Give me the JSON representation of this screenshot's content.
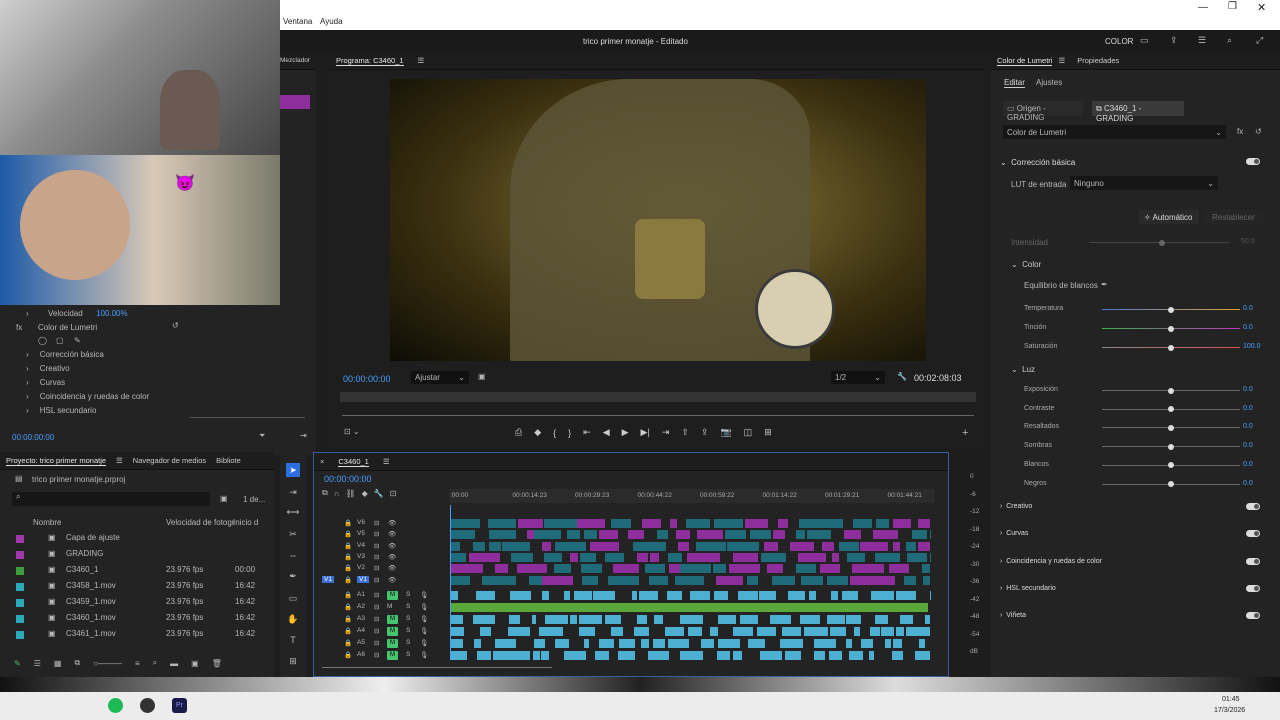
{
  "menu": {
    "items": [
      "Ventana",
      "Ayuda"
    ]
  },
  "window": {
    "title": "trico primer monatje - Editado",
    "workspace": "COLOR"
  },
  "source_tabs": {
    "mezclador": "Mezclador"
  },
  "effect_controls": {
    "velocidad_label": "Velocidad",
    "velocidad_value": "100.00%",
    "lumetri_label": "Color de Lumetri",
    "sections": [
      "Corrección básica",
      "Creativo",
      "Curvas",
      "Coincidencia y ruedas de color",
      "HSL secundario"
    ],
    "timecode": "00:00:00:00"
  },
  "program": {
    "title": "Programa: C3460_1",
    "timecode": "00:00:00:00",
    "fit": "Ajustar",
    "quality": "1/2",
    "duration": "00:02:08:03"
  },
  "project": {
    "tab_project": "Proyecto: trico primer monatje",
    "tab_media": "Navegador de medios",
    "tab_library": "Bibliote",
    "file": "trico primer monatje.prproj",
    "count": "1 de...",
    "col_name": "Nombre",
    "col_fps": "Velocidad de fotogr",
    "col_start": "Inicio d",
    "items": [
      {
        "name": "Capa de ajuste",
        "fps": "",
        "start": "",
        "color": "#9b3aa8"
      },
      {
        "name": "GRADING",
        "fps": "",
        "start": "",
        "color": "#9b3aa8"
      },
      {
        "name": "C3460_1",
        "fps": "23.976 fps",
        "start": "00:00",
        "color": "#3f9d3a"
      },
      {
        "name": "C3458_1.mov",
        "fps": "23.976 fps",
        "start": "16:42",
        "color": "#2aa7b8"
      },
      {
        "name": "C3459_1.mov",
        "fps": "23.976 fps",
        "start": "16:42",
        "color": "#2aa7b8"
      },
      {
        "name": "C3460_1.mov",
        "fps": "23.976 fps",
        "start": "16:42",
        "color": "#2aa7b8"
      },
      {
        "name": "C3461_1.mov",
        "fps": "23.976 fps",
        "start": "16:42",
        "color": "#2aa7b8"
      }
    ]
  },
  "timeline": {
    "tab": "C3460_1",
    "timecode": "00:00:00:00",
    "ruler": [
      ":00:00",
      "00:00:14:23",
      "00:00:29:23",
      "00:00:44:22",
      "00:00:59:22",
      "00:01:14:22",
      "00:01:29:21",
      "00:01:44:21"
    ],
    "video_tracks": [
      "V6",
      "V5",
      "V4",
      "V3",
      "V2",
      "V1"
    ],
    "audio_tracks": [
      "A1",
      "A2",
      "A3",
      "A4",
      "A5",
      "A6"
    ]
  },
  "meter": {
    "scale": [
      "0",
      "-6",
      "-12",
      "-18",
      "-24",
      "-30",
      "-36",
      "-42",
      "-48",
      "-54",
      "dB"
    ]
  },
  "lumetri": {
    "tab": "Color de Lumetri",
    "tab2": "Propiedades",
    "sub_edit": "Editar",
    "sub_adjust": "Ajustes",
    "source": "Origen - GRADING",
    "target": "C3460_1 - GRADING",
    "effect": "Color de Lumetri",
    "basic": "Corrección básica",
    "lut_label": "LUT de entrada",
    "lut_value": "Ninguno",
    "auto": "Automático",
    "reset": "Restablecer",
    "intensity": "Intensidad",
    "intensity_val": "50.0",
    "color": "Color",
    "wb": "Equilibrio de blancos",
    "sliders": [
      {
        "label": "Temperatura",
        "value": "0.0"
      },
      {
        "label": "Tinción",
        "value": "0.0"
      },
      {
        "label": "Saturación",
        "value": "100.0"
      }
    ],
    "light": "Luz",
    "light_sliders": [
      {
        "label": "Exposición",
        "value": "0.0"
      },
      {
        "label": "Contraste",
        "value": "0.0"
      },
      {
        "label": "Resaltados",
        "value": "0.0"
      },
      {
        "label": "Sombras",
        "value": "0.0"
      },
      {
        "label": "Blancos",
        "value": "0.0"
      },
      {
        "label": "Negros",
        "value": "0.0"
      }
    ],
    "groups": [
      "Creativo",
      "Curvas",
      "Coincidencia y ruedas de color",
      "HSL secundario",
      "Viñeta"
    ]
  },
  "taskbar": {
    "time": "01:45",
    "date": "17/3/2026"
  }
}
